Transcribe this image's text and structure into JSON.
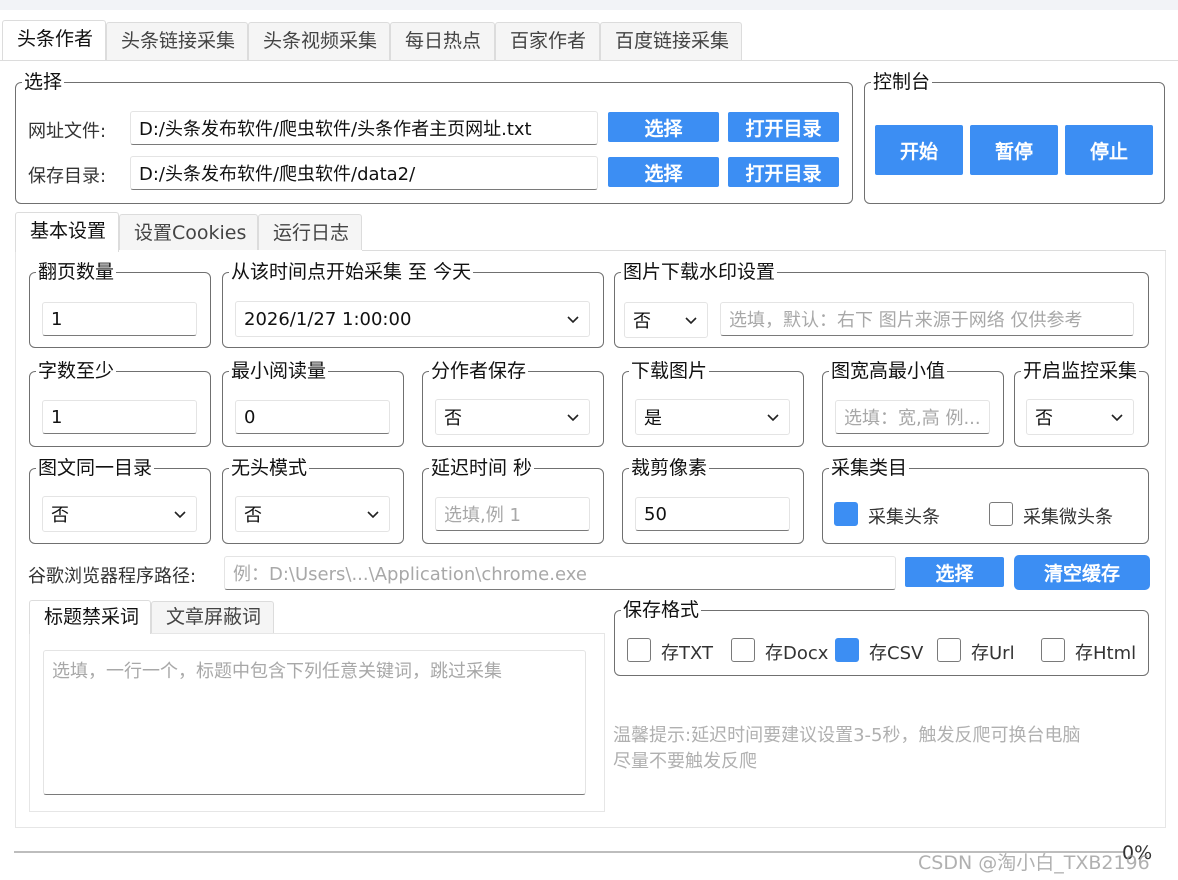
{
  "main_tabs": [
    "头条作者",
    "头条链接采集",
    "头条视频采集",
    "每日热点",
    "百家作者",
    "百度链接采集"
  ],
  "select_group": {
    "legend": "选择",
    "url_file_label": "网址文件:",
    "url_file_value": "D:/头条发布软件/爬虫软件/头条作者主页网址.txt",
    "save_dir_label": "保存目录:",
    "save_dir_value": "D:/头条发布软件/爬虫软件/data2/",
    "choose_label": "选择",
    "open_dir_label": "打开目录"
  },
  "console": {
    "legend": "控制台",
    "start": "开始",
    "pause": "暂停",
    "stop": "停止"
  },
  "sub_tabs": [
    "基本设置",
    "设置Cookies",
    "运行日志"
  ],
  "settings": {
    "pages": {
      "label": "翻页数量",
      "value": "1"
    },
    "start_time": {
      "label": "从该时间点开始采集 至 今天",
      "value": "2026/1/27 1:00:00"
    },
    "watermark": {
      "label": "图片下载水印设置",
      "select": "否",
      "placeholder": "选填，默认：右下 图片来源于网络 仅供参考"
    },
    "min_words": {
      "label": "字数至少",
      "value": "1"
    },
    "min_reads": {
      "label": "最小阅读量",
      "value": "0"
    },
    "by_author": {
      "label": "分作者保存",
      "value": "否"
    },
    "download_images": {
      "label": "下载图片",
      "value": "是"
    },
    "min_size": {
      "label": "图宽高最小值",
      "placeholder": "选填：宽,高 例..."
    },
    "monitor": {
      "label": "开启监控采集",
      "value": "否"
    },
    "same_dir": {
      "label": "图文同一目录",
      "value": "否"
    },
    "headless": {
      "label": "无头模式",
      "value": "否"
    },
    "delay": {
      "label": "延迟时间 秒",
      "placeholder": "选填,例 1"
    },
    "crop": {
      "label": "裁剪像素",
      "value": "50"
    },
    "category": {
      "label": "采集类目",
      "options": [
        {
          "label": "采集头条",
          "checked": true
        },
        {
          "label": "采集微头条",
          "checked": false
        }
      ]
    }
  },
  "chrome": {
    "label": "谷歌浏览器程序路径:",
    "placeholder": "例：D:\\Users\\...\\Application\\chrome.exe",
    "choose_label": "选择",
    "clear_label": "清空缓存"
  },
  "keyword_tabs": [
    "标题禁采词",
    "文章屏蔽词"
  ],
  "keyword_placeholder": "选填，一行一个，标题中包含下列任意关键词，跳过采集",
  "save_format": {
    "legend": "保存格式",
    "options": [
      {
        "label": "存TXT",
        "checked": false
      },
      {
        "label": "存Docx",
        "checked": false
      },
      {
        "label": "存CSV",
        "checked": true
      },
      {
        "label": "存Url",
        "checked": false
      },
      {
        "label": "存Html",
        "checked": false
      }
    ]
  },
  "tip": {
    "line1": "温馨提示:延迟时间要建议设置3-5秒，触发反爬可换台电脑",
    "line2": "尽量不要触发反爬"
  },
  "progress": {
    "text": "0%",
    "value": 0
  },
  "watermark_text": "CSDN @淘小白_TXB2196",
  "colors": {
    "accent": "#3c8ef3",
    "border": "#707070",
    "placeholder": "#a8a8a8"
  }
}
